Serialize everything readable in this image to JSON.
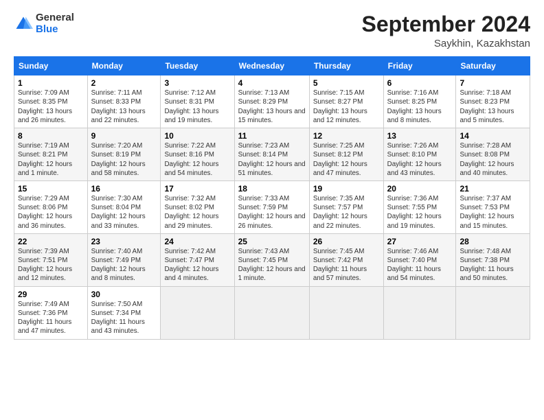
{
  "logo": {
    "line1": "General",
    "line2": "Blue"
  },
  "title": "September 2024",
  "location": "Saykhin, Kazakhstan",
  "days_of_week": [
    "Sunday",
    "Monday",
    "Tuesday",
    "Wednesday",
    "Thursday",
    "Friday",
    "Saturday"
  ],
  "weeks": [
    [
      {
        "day": 1,
        "sunrise": "7:09 AM",
        "sunset": "8:35 PM",
        "daylight": "13 hours and 26 minutes."
      },
      {
        "day": 2,
        "sunrise": "7:11 AM",
        "sunset": "8:33 PM",
        "daylight": "13 hours and 22 minutes."
      },
      {
        "day": 3,
        "sunrise": "7:12 AM",
        "sunset": "8:31 PM",
        "daylight": "13 hours and 19 minutes."
      },
      {
        "day": 4,
        "sunrise": "7:13 AM",
        "sunset": "8:29 PM",
        "daylight": "13 hours and 15 minutes."
      },
      {
        "day": 5,
        "sunrise": "7:15 AM",
        "sunset": "8:27 PM",
        "daylight": "13 hours and 12 minutes."
      },
      {
        "day": 6,
        "sunrise": "7:16 AM",
        "sunset": "8:25 PM",
        "daylight": "13 hours and 8 minutes."
      },
      {
        "day": 7,
        "sunrise": "7:18 AM",
        "sunset": "8:23 PM",
        "daylight": "13 hours and 5 minutes."
      }
    ],
    [
      {
        "day": 8,
        "sunrise": "7:19 AM",
        "sunset": "8:21 PM",
        "daylight": "12 hours and 1 minute."
      },
      {
        "day": 9,
        "sunrise": "7:20 AM",
        "sunset": "8:19 PM",
        "daylight": "12 hours and 58 minutes."
      },
      {
        "day": 10,
        "sunrise": "7:22 AM",
        "sunset": "8:16 PM",
        "daylight": "12 hours and 54 minutes."
      },
      {
        "day": 11,
        "sunrise": "7:23 AM",
        "sunset": "8:14 PM",
        "daylight": "12 hours and 51 minutes."
      },
      {
        "day": 12,
        "sunrise": "7:25 AM",
        "sunset": "8:12 PM",
        "daylight": "12 hours and 47 minutes."
      },
      {
        "day": 13,
        "sunrise": "7:26 AM",
        "sunset": "8:10 PM",
        "daylight": "12 hours and 43 minutes."
      },
      {
        "day": 14,
        "sunrise": "7:28 AM",
        "sunset": "8:08 PM",
        "daylight": "12 hours and 40 minutes."
      }
    ],
    [
      {
        "day": 15,
        "sunrise": "7:29 AM",
        "sunset": "8:06 PM",
        "daylight": "12 hours and 36 minutes."
      },
      {
        "day": 16,
        "sunrise": "7:30 AM",
        "sunset": "8:04 PM",
        "daylight": "12 hours and 33 minutes."
      },
      {
        "day": 17,
        "sunrise": "7:32 AM",
        "sunset": "8:02 PM",
        "daylight": "12 hours and 29 minutes."
      },
      {
        "day": 18,
        "sunrise": "7:33 AM",
        "sunset": "7:59 PM",
        "daylight": "12 hours and 26 minutes."
      },
      {
        "day": 19,
        "sunrise": "7:35 AM",
        "sunset": "7:57 PM",
        "daylight": "12 hours and 22 minutes."
      },
      {
        "day": 20,
        "sunrise": "7:36 AM",
        "sunset": "7:55 PM",
        "daylight": "12 hours and 19 minutes."
      },
      {
        "day": 21,
        "sunrise": "7:37 AM",
        "sunset": "7:53 PM",
        "daylight": "12 hours and 15 minutes."
      }
    ],
    [
      {
        "day": 22,
        "sunrise": "7:39 AM",
        "sunset": "7:51 PM",
        "daylight": "12 hours and 12 minutes."
      },
      {
        "day": 23,
        "sunrise": "7:40 AM",
        "sunset": "7:49 PM",
        "daylight": "12 hours and 8 minutes."
      },
      {
        "day": 24,
        "sunrise": "7:42 AM",
        "sunset": "7:47 PM",
        "daylight": "12 hours and 4 minutes."
      },
      {
        "day": 25,
        "sunrise": "7:43 AM",
        "sunset": "7:45 PM",
        "daylight": "12 hours and 1 minute."
      },
      {
        "day": 26,
        "sunrise": "7:45 AM",
        "sunset": "7:42 PM",
        "daylight": "11 hours and 57 minutes."
      },
      {
        "day": 27,
        "sunrise": "7:46 AM",
        "sunset": "7:40 PM",
        "daylight": "11 hours and 54 minutes."
      },
      {
        "day": 28,
        "sunrise": "7:48 AM",
        "sunset": "7:38 PM",
        "daylight": "11 hours and 50 minutes."
      }
    ],
    [
      {
        "day": 29,
        "sunrise": "7:49 AM",
        "sunset": "7:36 PM",
        "daylight": "11 hours and 47 minutes."
      },
      {
        "day": 30,
        "sunrise": "7:50 AM",
        "sunset": "7:34 PM",
        "daylight": "11 hours and 43 minutes."
      },
      null,
      null,
      null,
      null,
      null
    ]
  ]
}
